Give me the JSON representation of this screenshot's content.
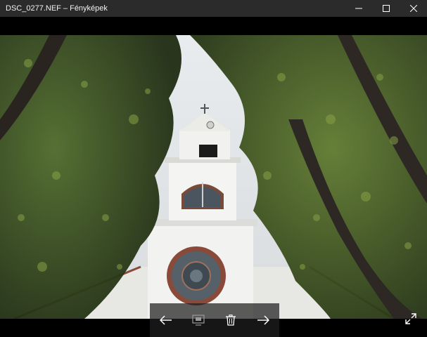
{
  "window": {
    "title": "DSC_0277.NEF – Fényképek",
    "controls": [
      "minimize-icon",
      "maximize-icon",
      "close-icon"
    ]
  },
  "viewer": {
    "photo_subject": "church tower framed by trees, viewed from below",
    "toolbar_icons": [
      "arrow-left-icon",
      "slideshow-icon",
      "trash-icon",
      "arrow-right-icon"
    ],
    "fullscreen_icon": "expand-icon"
  },
  "colors": {
    "titlebar": "#2b2b2b",
    "background": "#000000",
    "toolbar": "#1e1e1e"
  }
}
